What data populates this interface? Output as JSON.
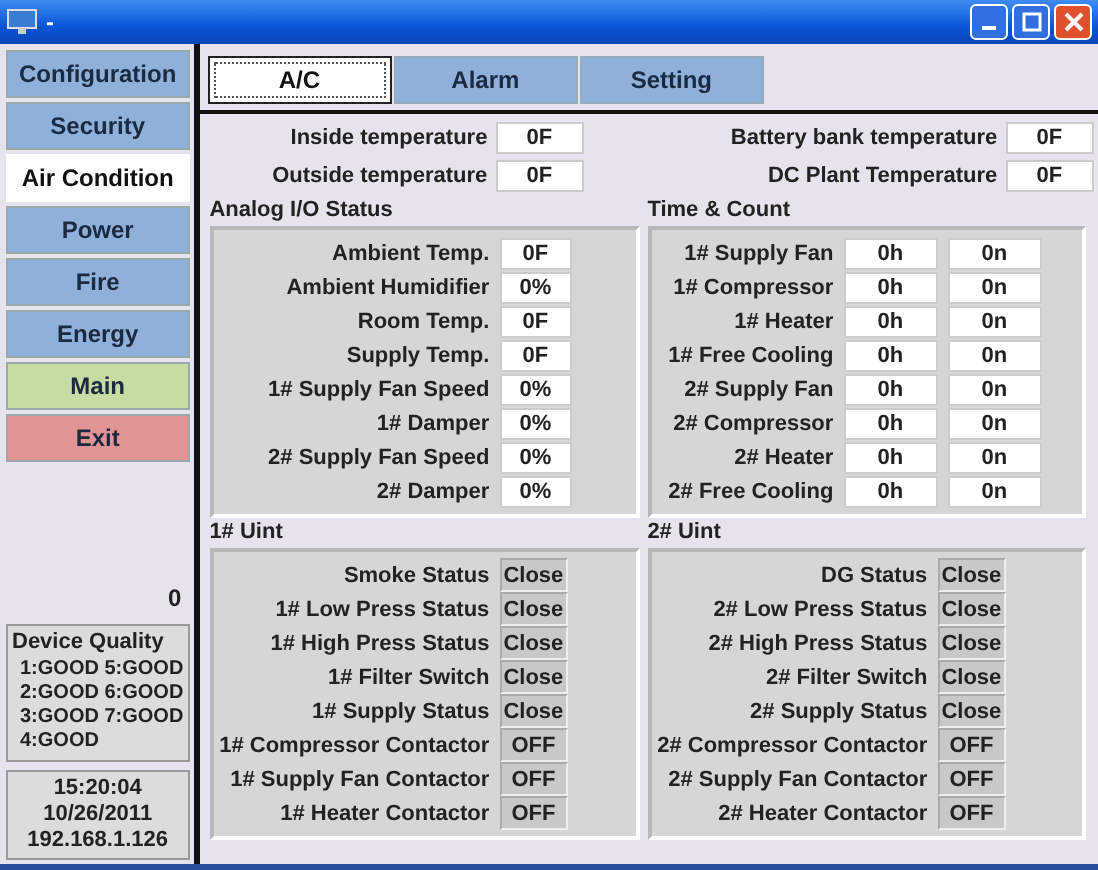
{
  "window": {
    "title": "-"
  },
  "sidebar": {
    "items": [
      {
        "label": "Configuration",
        "kind": "nav",
        "selected": false
      },
      {
        "label": "Security",
        "kind": "nav",
        "selected": false
      },
      {
        "label": "Air Condition",
        "kind": "nav",
        "selected": true
      },
      {
        "label": "Power",
        "kind": "nav",
        "selected": false
      },
      {
        "label": "Fire",
        "kind": "nav",
        "selected": false
      },
      {
        "label": "Energy",
        "kind": "nav",
        "selected": false
      },
      {
        "label": "Main",
        "kind": "main",
        "selected": false
      },
      {
        "label": "Exit",
        "kind": "exit",
        "selected": false
      }
    ],
    "counter": "0",
    "device_quality": {
      "title": "Device Quality",
      "lines": [
        "1:GOOD 5:GOOD",
        "2:GOOD 6:GOOD",
        "3:GOOD 7:GOOD",
        "4:GOOD"
      ]
    },
    "status": [
      "15:20:04",
      "10/26/2011",
      "192.168.1.126"
    ]
  },
  "tabs": [
    {
      "label": "A/C",
      "selected": true
    },
    {
      "label": "Alarm",
      "selected": false
    },
    {
      "label": "Setting",
      "selected": false
    }
  ],
  "summary": [
    {
      "label": "Inside temperature",
      "value": "0F"
    },
    {
      "label": "Battery bank temperature",
      "value": "0F"
    },
    {
      "label": "Outside temperature",
      "value": "0F"
    },
    {
      "label": "DC Plant Temperature",
      "value": "0F"
    }
  ],
  "analog_io": {
    "title": "Analog I/O Status",
    "rows": [
      {
        "label": "Ambient Temp.",
        "value": "0F"
      },
      {
        "label": "Ambient Humidifier",
        "value": "0%"
      },
      {
        "label": "Room Temp.",
        "value": "0F"
      },
      {
        "label": "Supply Temp.",
        "value": "0F"
      },
      {
        "label": "1# Supply Fan Speed",
        "value": "0%"
      },
      {
        "label": "1# Damper",
        "value": "0%"
      },
      {
        "label": "2# Supply Fan Speed",
        "value": "0%"
      },
      {
        "label": "2# Damper",
        "value": "0%"
      }
    ]
  },
  "time_count": {
    "title": "Time & Count",
    "rows": [
      {
        "label": "1# Supply Fan",
        "hours": "0h",
        "count": "0n"
      },
      {
        "label": "1# Compressor",
        "hours": "0h",
        "count": "0n"
      },
      {
        "label": "1# Heater",
        "hours": "0h",
        "count": "0n"
      },
      {
        "label": "1# Free Cooling",
        "hours": "0h",
        "count": "0n"
      },
      {
        "label": "2# Supply Fan",
        "hours": "0h",
        "count": "0n"
      },
      {
        "label": "2# Compressor",
        "hours": "0h",
        "count": "0n"
      },
      {
        "label": "2# Heater",
        "hours": "0h",
        "count": "0n"
      },
      {
        "label": "2# Free Cooling",
        "hours": "0h",
        "count": "0n"
      }
    ]
  },
  "units": [
    {
      "title": "1# Uint",
      "rows": [
        {
          "label": "Smoke Status",
          "value": "Close"
        },
        {
          "label": "1# Low Press Status",
          "value": "Close"
        },
        {
          "label": "1# High Press Status",
          "value": "Close"
        },
        {
          "label": "1# Filter Switch",
          "value": "Close"
        },
        {
          "label": "1# Supply Status",
          "value": "Close"
        },
        {
          "label": "1# Compressor Contactor",
          "value": "OFF"
        },
        {
          "label": "1# Supply Fan Contactor",
          "value": "OFF"
        },
        {
          "label": "1# Heater Contactor",
          "value": "OFF"
        }
      ]
    },
    {
      "title": "2# Uint",
      "rows": [
        {
          "label": "DG Status",
          "value": "Close"
        },
        {
          "label": "2# Low Press Status",
          "value": "Close"
        },
        {
          "label": "2# High Press Status",
          "value": "Close"
        },
        {
          "label": "2# Filter Switch",
          "value": "Close"
        },
        {
          "label": "2# Supply Status",
          "value": "Close"
        },
        {
          "label": "2# Compressor Contactor",
          "value": "OFF"
        },
        {
          "label": "2# Supply Fan Contactor",
          "value": "OFF"
        },
        {
          "label": "2# Heater Contactor",
          "value": "OFF"
        }
      ]
    }
  ]
}
